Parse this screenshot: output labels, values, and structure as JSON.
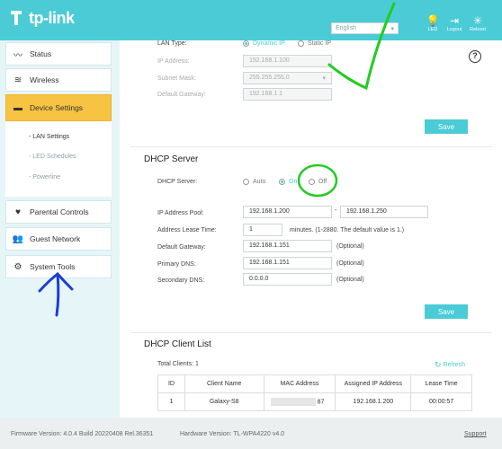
{
  "header": {
    "brand": "tp-link",
    "language": "English",
    "icons": [
      {
        "name": "led-icon",
        "label": "LED"
      },
      {
        "name": "logout-icon",
        "label": "Logout"
      },
      {
        "name": "reboot-icon",
        "label": "Reboot"
      }
    ]
  },
  "sidebar": {
    "items": [
      {
        "label": "Status",
        "icon": "status-icon"
      },
      {
        "label": "Wireless",
        "icon": "wireless-icon"
      },
      {
        "label": "Device Settings",
        "icon": "device-settings-icon"
      },
      {
        "label": "Parental Controls",
        "icon": "parental-controls-icon"
      },
      {
        "label": "Guest Network",
        "icon": "guest-network-icon"
      },
      {
        "label": "System Tools",
        "icon": "system-tools-icon"
      }
    ],
    "submenu": [
      "- LAN Settings",
      "- LED Schedules",
      "- Powerline"
    ]
  },
  "lan": {
    "type_label": "LAN Type:",
    "dynamic_ip": "Dynamic IP",
    "static_ip": "Static IP",
    "ip_label": "IP Address:",
    "ip_value": "192.168.1.100",
    "mask_label": "Subnet Mask:",
    "mask_value": "255.255.255.0",
    "gateway_label": "Default Gateway:",
    "gateway_value": "192.168.1.1",
    "save": "Save"
  },
  "dhcp": {
    "title": "DHCP Server",
    "server_label": "DHCP Server:",
    "options": [
      "Auto",
      "On",
      "Off"
    ],
    "pool_label": "IP Address Pool:",
    "pool_start": "192.168.1.200",
    "pool_sep": "-",
    "pool_end": "192.168.1.250",
    "lease_label": "Address Lease Time:",
    "lease_value": "1",
    "lease_hint": "minutes. (1-2880. The default value is 1.)",
    "gateway_label": "Default Gateway:",
    "gateway_value": "192.168.1.151",
    "primary_label": "Primary DNS:",
    "primary_value": "192.168.1.151",
    "secondary_label": "Secondary DNS:",
    "secondary_value": "0.0.0.0",
    "optional": "(Optional)",
    "save": "Save"
  },
  "clients": {
    "title": "DHCP Client List",
    "total": "Total Clients: 1",
    "refresh": "Refresh",
    "headers": [
      "ID",
      "Client Name",
      "MAC Address",
      "Assigned IP Address",
      "Lease Time"
    ],
    "rows": [
      {
        "id": "1",
        "name": "Galaxy-S8",
        "mac": "87",
        "ip": "192.168.1.200",
        "lease": "00:00:57"
      }
    ]
  },
  "footer": {
    "firmware": "Firmware Version: 4.0.4 Build 20220408 Rel.36351",
    "hardware": "Hardware Version: TL-WPA4220 v4.0",
    "support": "Support"
  },
  "colors": {
    "accent": "#4acbd6",
    "active_nav": "#f6c343",
    "annotation_green": "#22cc22",
    "annotation_blue": "#1a3fd6"
  }
}
